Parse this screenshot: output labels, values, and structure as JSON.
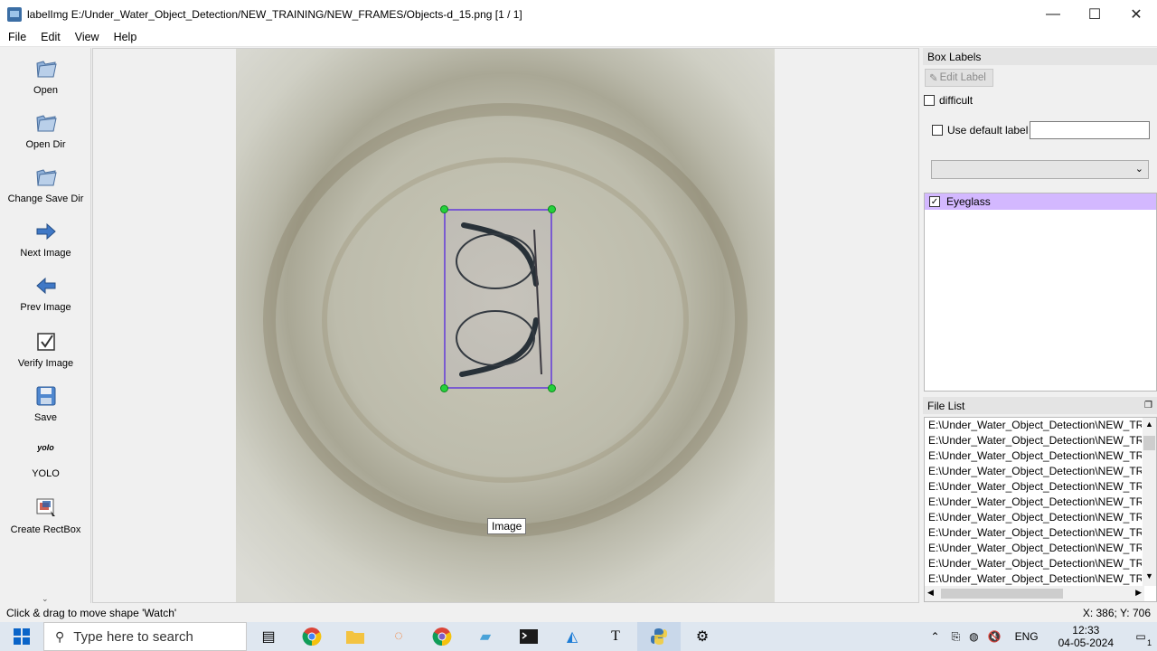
{
  "window": {
    "title": "labelImg E:/Under_Water_Object_Detection/NEW_TRAINING/NEW_FRAMES/Objects-d_15.png [1 / 1]",
    "minimize": "—",
    "maximize": "☐",
    "close": "✕"
  },
  "menu": [
    "File",
    "Edit",
    "View",
    "Help"
  ],
  "toolbar": [
    {
      "label": "Open",
      "icon": "open-icon"
    },
    {
      "label": "Open Dir",
      "icon": "open-dir-icon"
    },
    {
      "label": "Change Save Dir",
      "icon": "change-save-dir-icon"
    },
    {
      "label": "Next Image",
      "icon": "next-arrow-icon"
    },
    {
      "label": "Prev Image",
      "icon": "prev-arrow-icon"
    },
    {
      "label": "Verify Image",
      "icon": "verify-check-icon"
    },
    {
      "label": "Save",
      "icon": "save-icon"
    },
    {
      "label": "YOLO",
      "icon": "yolo-icon",
      "icon_text": "yolo"
    },
    {
      "label": "Create RectBox",
      "icon": "create-rectbox-icon"
    }
  ],
  "canvas": {
    "tooltip": "Image"
  },
  "box_labels": {
    "title": "Box Labels",
    "edit_label": "Edit Label",
    "difficult": "difficult",
    "use_default_label": "Use default label",
    "default_label_value": "",
    "labels": [
      {
        "text": "Eyeglass",
        "checked": true
      }
    ]
  },
  "file_list": {
    "title": "File List",
    "files": [
      "E:\\Under_Water_Object_Detection\\NEW_TRA",
      "E:\\Under_Water_Object_Detection\\NEW_TRA",
      "E:\\Under_Water_Object_Detection\\NEW_TRA",
      "E:\\Under_Water_Object_Detection\\NEW_TRA",
      "E:\\Under_Water_Object_Detection\\NEW_TRA",
      "E:\\Under_Water_Object_Detection\\NEW_TRA",
      "E:\\Under_Water_Object_Detection\\NEW_TRA",
      "E:\\Under_Water_Object_Detection\\NEW_TRA",
      "E:\\Under_Water_Object_Detection\\NEW_TRA",
      "E:\\Under_Water_Object_Detection\\NEW_TRA",
      "E:\\Under_Water_Object_Detection\\NEW_TRA"
    ]
  },
  "status": {
    "message": "Click & drag to move shape 'Watch'",
    "coords": "X: 386; Y: 706"
  },
  "taskbar": {
    "search_placeholder": "Type here to search",
    "lang": "ENG",
    "time": "12:33",
    "date": "04-05-2024",
    "notifications": "1"
  },
  "colors": {
    "selected_label_bg": "#d3b8ff",
    "bbox_stroke": "#7a5bd0",
    "handle_fill": "#25d03c"
  }
}
